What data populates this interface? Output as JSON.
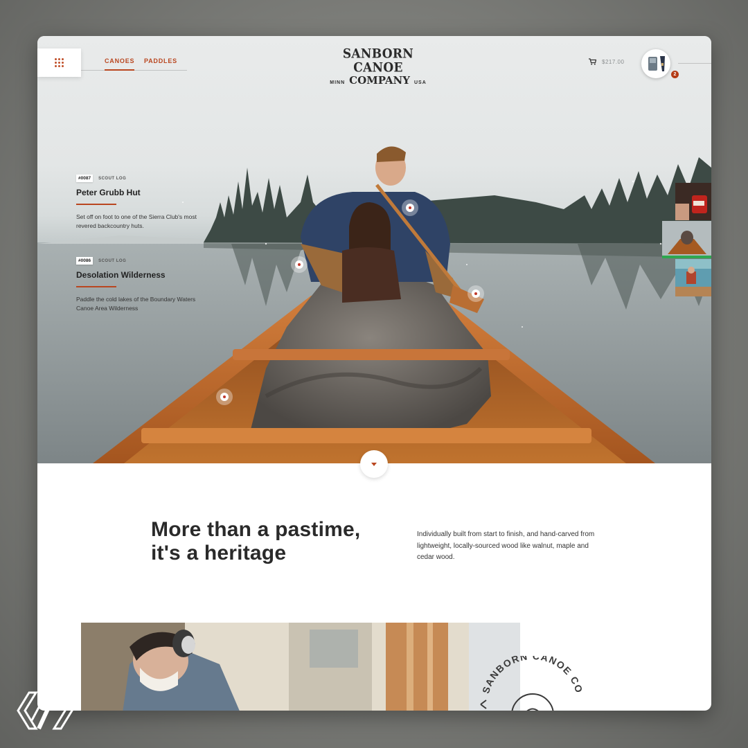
{
  "nav": {
    "menu_icon": "grid-icon",
    "links": [
      "CANOES",
      "PADDLES"
    ],
    "active": "CANOES"
  },
  "logo": {
    "line1": "SANBORN CANOE",
    "left_small": "MINN",
    "line2": "COMPANY",
    "right_small": "USA"
  },
  "cart": {
    "icon": "cart-icon",
    "total": "$217.00",
    "count": "2"
  },
  "logs": [
    {
      "number": "#0087",
      "type": "SCOUT LOG",
      "title": "Peter Grubb Hut",
      "description": "Set off on foot to one of the Sierra Club's most revered backcountry huts."
    },
    {
      "number": "#0086",
      "type": "SCOUT LOG",
      "title": "Desolation Wilderness",
      "description": "Paddle the cold lakes of the Boundary Waters Canoe Area Wilderness"
    }
  ],
  "section": {
    "headline_line1": "More than a pastime,",
    "headline_line2": "it's a heritage",
    "body": "Individually built from start to finish, and hand-carved from lightweight, locally-sourced wood like walnut, maple and cedar wood."
  },
  "stamp_text": "SANBORN CANOE CO",
  "colors": {
    "accent": "#b9461f",
    "text": "#2a2a2a"
  }
}
